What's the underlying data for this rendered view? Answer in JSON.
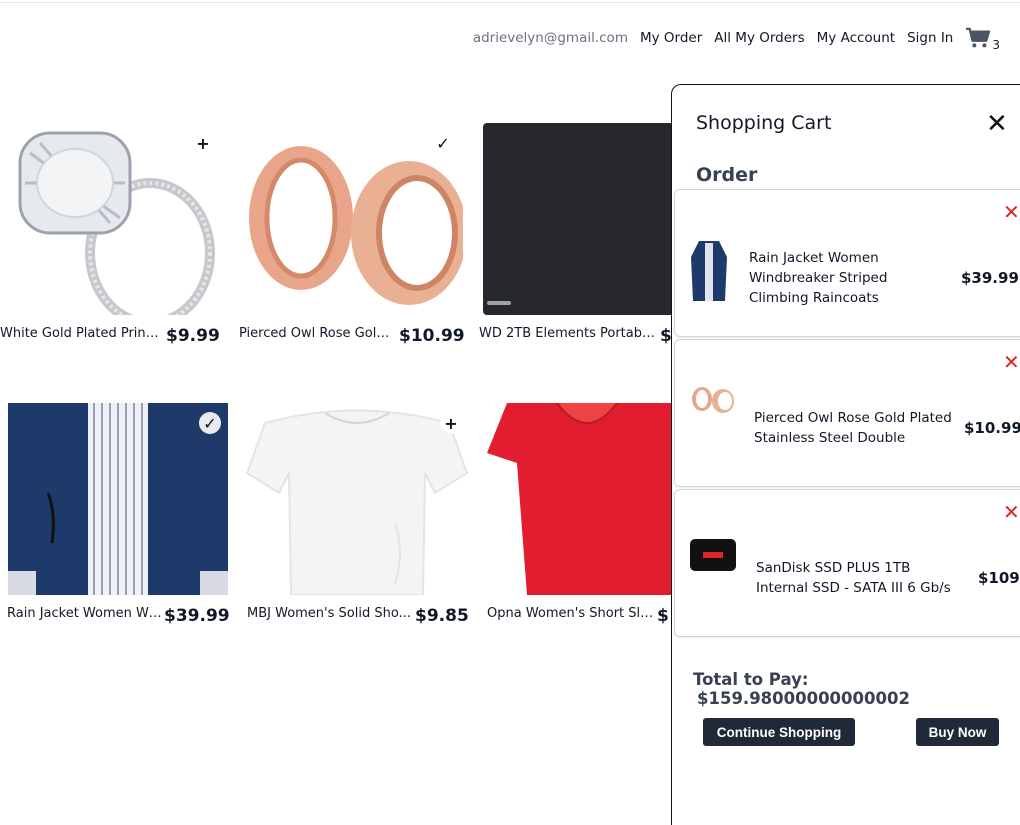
{
  "header": {
    "email": "adrievelyn@gmail.com",
    "links": [
      "My Order",
      "All My Orders",
      "My Account",
      "Sign In"
    ],
    "cart_count": "3"
  },
  "products": [
    {
      "title": "White Gold Plated Princ...",
      "price": "$9.99",
      "badge": "+"
    },
    {
      "title": "Pierced Owl Rose Gold...",
      "price": "$10.99",
      "badge": "✓"
    },
    {
      "title": "WD 2TB Elements Portabl...",
      "price": "$",
      "badge": ""
    },
    {
      "title": "Rain Jacket Women Wi...",
      "price": "$39.99",
      "badge": "✓"
    },
    {
      "title": "MBJ Women's Solid Sho...",
      "price": "$9.85",
      "badge": "+"
    },
    {
      "title": "Opna Women's Short Sle...",
      "price": "$",
      "badge": ""
    }
  ],
  "cart_panel": {
    "title": "Shopping Cart",
    "section": "Order",
    "items": [
      {
        "name": "Rain Jacket Women Windbreaker Striped Climbing Raincoats",
        "price": "$39.99",
        "remove": "✕"
      },
      {
        "name": "Pierced Owl Rose Gold Plated Stainless Steel Double",
        "price": "$10.99",
        "remove": "✕"
      },
      {
        "name": "SanDisk SSD PLUS 1TB Internal SSD - SATA III 6 Gb/s",
        "price": "$109",
        "remove": "✕"
      }
    ],
    "total_label": "Total to Pay:",
    "total_value": "$159.98000000000002",
    "continue_label": "Continue Shopping",
    "buy_label": "Buy Now",
    "close_glyph": "✕"
  },
  "colors": {
    "accent_dark": "#1f2937",
    "remove_red": "#dc2626"
  }
}
